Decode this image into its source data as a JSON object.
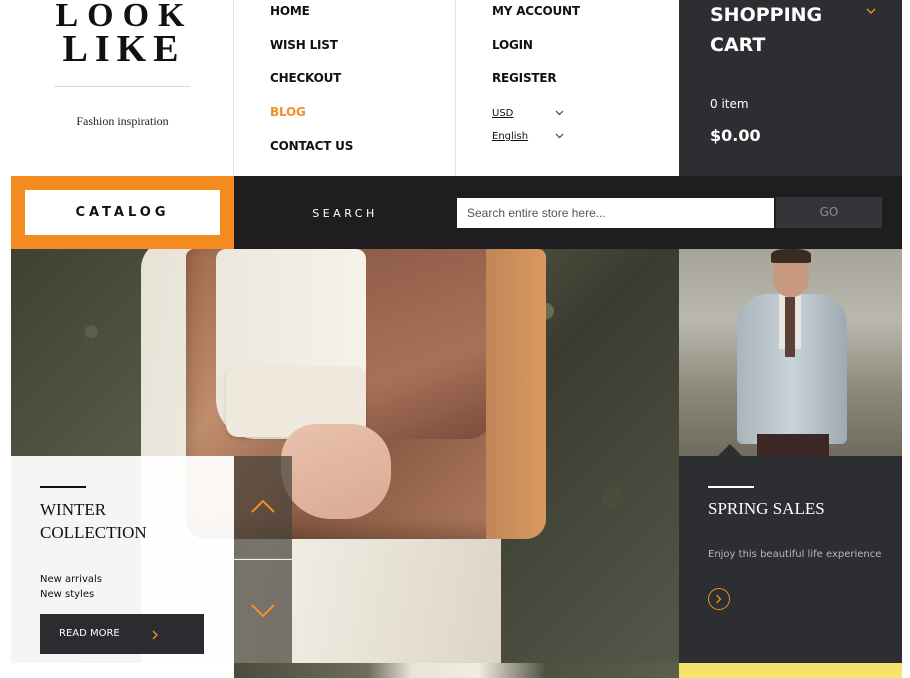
{
  "brand": {
    "logo_line1": "LOOK",
    "logo_line2": "LIKE",
    "tagline": "Fashion inspiration"
  },
  "nav": {
    "col1": [
      {
        "label": "HOME",
        "active": false
      },
      {
        "label": "WISH LIST",
        "active": false
      },
      {
        "label": "CHECKOUT",
        "active": false
      },
      {
        "label": "BLOG",
        "active": true
      },
      {
        "label": "CONTACT US",
        "active": false
      }
    ],
    "col2": [
      {
        "label": "MY ACCOUNT"
      },
      {
        "label": "LOGIN"
      },
      {
        "label": "REGISTER"
      }
    ],
    "currency": "USD",
    "language": "English"
  },
  "cart": {
    "title": "SHOPPING CART",
    "items": "0 item",
    "total": "$0.00"
  },
  "bar": {
    "catalog_label": "CATALOG",
    "search_label": "SEARCH",
    "search_placeholder": "Search entire store here...",
    "go_label": "GO"
  },
  "hero": {
    "title_line1": "WINTER",
    "title_line2": "COLLECTION",
    "sub_line1": "New arrivals",
    "sub_line2": "New styles",
    "read_more": "READ MORE"
  },
  "promo": {
    "title": "SPRING SALES",
    "subtitle": "Enjoy this beautiful life experience"
  },
  "colors": {
    "accent": "#f39129",
    "dark": "#2c2e31",
    "bar": "#1e1e20",
    "yellow": "#f7e26b"
  }
}
